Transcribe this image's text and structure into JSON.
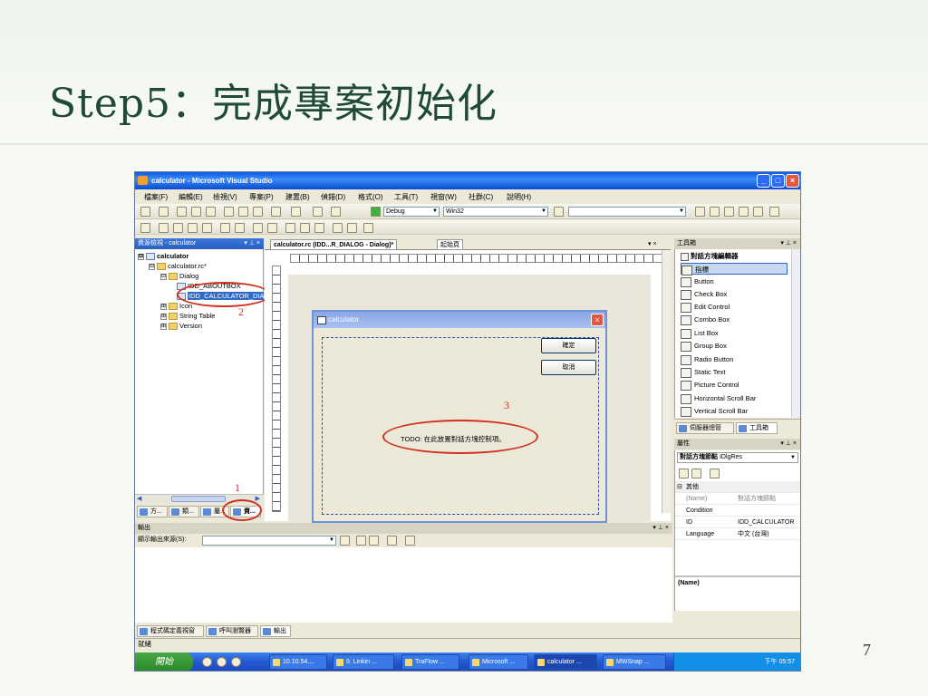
{
  "slide": {
    "title": "Step5：完成專案初始化",
    "page_number": "7"
  },
  "window": {
    "title": "calculator - Microsoft Visual Studio",
    "controls": [
      "_",
      "□",
      "×"
    ]
  },
  "menu": [
    "檔案(F)",
    "編輯(E)",
    "檢視(V)",
    "專案(P)",
    "建置(B)",
    "偵錯(D)",
    "格式(O)",
    "工具(T)",
    "視窗(W)",
    "社群(C)",
    "說明(H)"
  ],
  "toolbar": {
    "config": "Debug",
    "platform": "Win32"
  },
  "solution_explorer": {
    "header": "資源檢視 - calculator",
    "controls": "▾ ⊥ ×",
    "tree": [
      {
        "label": "calculator",
        "toggle": "⊟"
      },
      {
        "label": "calculator.rc*",
        "toggle": "⊟"
      },
      {
        "label": "Dialog",
        "toggle": "⊟"
      },
      {
        "label": "IDD_ABOUTBOX",
        "toggle": ""
      },
      {
        "label": "IDD_CALCULATOR_DIALOG",
        "toggle": ""
      },
      {
        "label": "Icon",
        "toggle": "⊞"
      },
      {
        "label": "String Table",
        "toggle": "⊞"
      },
      {
        "label": "Version",
        "toggle": "⊞"
      }
    ],
    "tabs": [
      "方...",
      "類...",
      "屬...",
      "資..."
    ]
  },
  "annotations": {
    "one": "1",
    "two": "2",
    "three": "3"
  },
  "editor": {
    "tabs": [
      "calculator.rc (IDD...R_DIALOG - Dialog)*",
      "起始頁"
    ],
    "controls": "▾ ×"
  },
  "dialog": {
    "title": "calculator",
    "ok": "確定",
    "cancel": "取消",
    "todo": "TODO: 在此放置對話方塊控制項。"
  },
  "toolbox": {
    "header": "工具箱",
    "controls": "▾ ⊥ ×",
    "group": "對話方塊編輯器",
    "items": [
      "指標",
      "Button",
      "Check Box",
      "Edit Control",
      "Combo Box",
      "List Box",
      "Group Box",
      "Radio Button",
      "Static Text",
      "Picture Control",
      "Horizontal Scroll Bar",
      "Vertical Scroll Bar"
    ],
    "tabs": [
      "伺服器總管",
      "工具箱"
    ]
  },
  "properties": {
    "header": "屬性",
    "controls": "▾ ⊥ ×",
    "object": "對話方塊節點",
    "object_type": "IDlgRes",
    "category": "其他",
    "rows": [
      {
        "key": "(Name)",
        "value": "對話方塊節點"
      },
      {
        "key": "Condition",
        "value": ""
      },
      {
        "key": "ID",
        "value": "IDD_CALCULATOR"
      },
      {
        "key": "Language",
        "value": "中文 (台灣)"
      }
    ],
    "description": "(Name)"
  },
  "output": {
    "header": "輸出",
    "controls": "▾ ⊥ ×",
    "source_label": "顯示輸出來源(S):",
    "tabs": [
      "程式碼定義視窗",
      "呼叫瀏覽器",
      "輸出"
    ]
  },
  "statusbar": {
    "text": "就緒"
  },
  "taskbar": {
    "start": "開始",
    "tasks": [
      "10.10.54....",
      "9. Linkin ...",
      "TraFlow ...",
      "Microsoft ...",
      "calculator ...",
      "MWSnap ..."
    ],
    "clock": "下午 05:57"
  }
}
